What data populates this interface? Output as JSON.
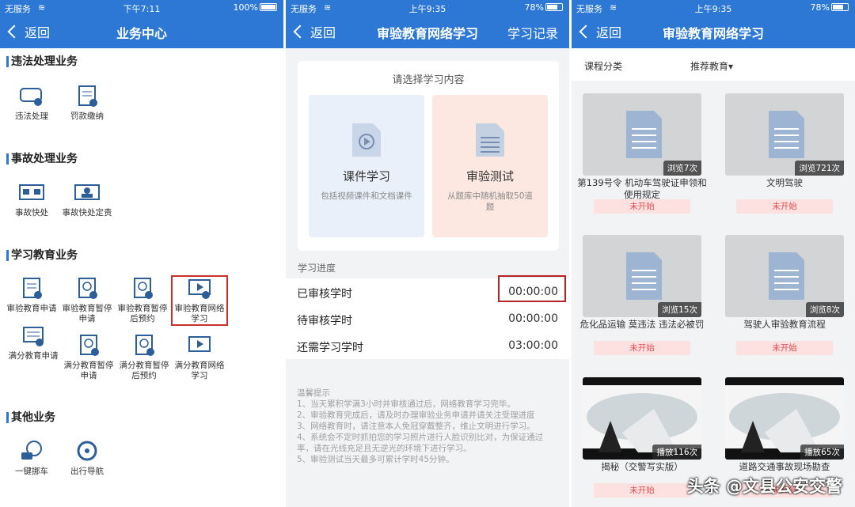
{
  "p1": {
    "status": {
      "carrier": "无服务",
      "time": "下午7:11",
      "battery": "100%"
    },
    "nav": {
      "back": "返回",
      "title": "业务中心"
    },
    "sections": [
      {
        "title": "违法处理业务",
        "items": [
          "违法处理",
          "罚款缴纳"
        ]
      },
      {
        "title": "事故处理业务",
        "items": [
          "事故快处",
          "事故快处定责"
        ]
      },
      {
        "title": "学习教育业务",
        "items": [
          "审验教育申请",
          "审验教育暂停申请",
          "审验教育暂停后预约",
          "审验教育网络学习",
          "满分教育申请",
          "满分教育暂停申请",
          "满分教育暂停后预约",
          "满分教育网络学习"
        ]
      },
      {
        "title": "其他业务",
        "items": [
          "一键挪车",
          "出行导航"
        ]
      }
    ]
  },
  "p2": {
    "status": {
      "carrier": "无服务",
      "time": "上午9:35",
      "battery": "78%"
    },
    "nav": {
      "back": "返回",
      "title": "审验教育网络学习",
      "right": "学习记录"
    },
    "card_header": "请选择学习内容",
    "option1": {
      "name": "课件学习",
      "desc": "包括视频课件和文档课件"
    },
    "option2": {
      "name": "审验测试",
      "desc": "从题库中随机抽取50道题"
    },
    "progress_label": "学习进度",
    "rows": [
      {
        "label": "已审核学时",
        "value": "00:00:00"
      },
      {
        "label": "待审核学时",
        "value": "00:00:00"
      },
      {
        "label": "还需学习学时",
        "value": "03:00:00"
      }
    ],
    "tips": "温馨提示\n1、当天累积学满3小时并审核通过后，网络教育学习完毕。\n2、审验教育完成后，请及时办理审验业务申请并请关注受理进度\n3、网络教育时，请注意本人免冠穿戴整齐，维止文明进行学习。\n4、系统会不定时抓拍您的学习照片进行人脸识别比对，为保证通过率，请在光线充足且无逆光的环境下进行学习。\n5、审验测试当天最多可累计学时45分钟。"
  },
  "p3": {
    "status": {
      "carrier": "无服务",
      "time": "上午9:35",
      "battery": "78%"
    },
    "nav": {
      "back": "返回",
      "title": "审验教育网络学习"
    },
    "filter": {
      "category": "课程分类",
      "recommend": "推荐教育▾"
    },
    "courses": [
      {
        "views": "浏览7次",
        "title": "第139号令 机动车驾驶证申领和使用规定",
        "status": "未开始"
      },
      {
        "views": "浏览721次",
        "title": "文明驾驶",
        "status": "未开始"
      },
      {
        "views": "浏览15次",
        "title": "危化品运输 莫违法 违法必被罚",
        "status": "未开始"
      },
      {
        "views": "浏览8次",
        "title": "驾驶人审验教育流程",
        "status": "未开始"
      },
      {
        "views": "播放116次",
        "title": "揭秘（交警写实版）",
        "status": "未开始"
      },
      {
        "views": "播放65次",
        "title": "道路交通事故现场勘查",
        "status": "未开始"
      }
    ],
    "watermark": "头条 @文县公安交警"
  }
}
